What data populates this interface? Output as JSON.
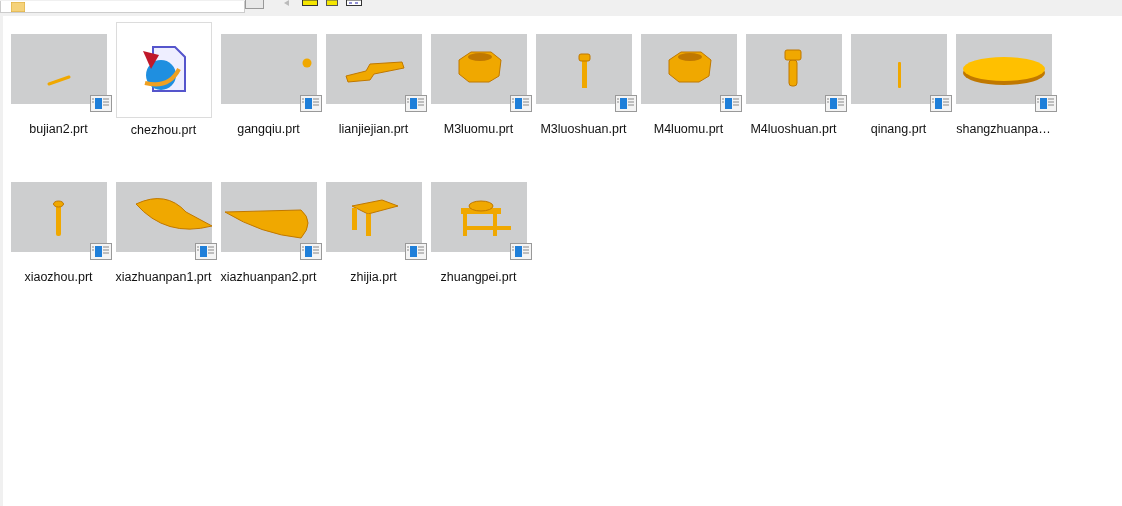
{
  "files": [
    {
      "name": "bujian2.prt",
      "kind": "part"
    },
    {
      "name": "chezhou.prt",
      "kind": "document"
    },
    {
      "name": "gangqiu.prt",
      "kind": "part"
    },
    {
      "name": "lianjiejian.prt",
      "kind": "part"
    },
    {
      "name": "M3luomu.prt",
      "kind": "part"
    },
    {
      "name": "M3luoshuan.prt",
      "kind": "part"
    },
    {
      "name": "M4luomu.prt",
      "kind": "part"
    },
    {
      "name": "M4luoshuan.prt",
      "kind": "part"
    },
    {
      "name": "qinang.prt",
      "kind": "part"
    },
    {
      "name": "shangzhuanpa…",
      "kind": "part"
    },
    {
      "name": "xiaozhou.prt",
      "kind": "part"
    },
    {
      "name": "xiazhuanpan1.prt",
      "kind": "part"
    },
    {
      "name": "xiazhuanpan2.prt",
      "kind": "part"
    },
    {
      "name": "zhijia.prt",
      "kind": "part"
    },
    {
      "name": "zhuangpei.prt",
      "kind": "part"
    }
  ]
}
